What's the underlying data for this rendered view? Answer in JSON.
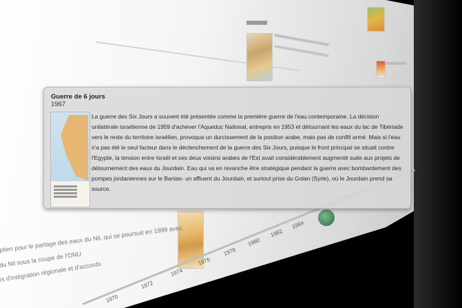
{
  "popover": {
    "title": "Guerre de 6 jours",
    "year": "1967",
    "body": "La guerre des Six Jours a souvent été présentée comme la première guerre de l'eau contemporaine. La décision unilatérale israélienne de 1959 d'achever l'Aqueduc National, entrepris en 1953 et détournant les eaux du lac de Tibériade vers le reste du territoire israélien, provoqua un durcissement de la position arabe, mais pas de conflit armé.  Mais si l'eau n'a pas été le seul facteur dans le déclenchement de la guerre des Six Jours, puisque le front principal se situait contre l'Egypte, la tension entre Israël et ses deux voisins arabes de l'Est avait considérablement augmenté suite aux projets de détournement des eaux du Jourdain. Eau qui va en revanche être stratégique pendant la guerre avec bombardement des pompes jordaniennes sur le Banias- un affluent du Jourdain, et surtout prise du Golan (Syrie), où le Jourdain prend sa source."
  },
  "background": {
    "bottom_lines": [
      "ptien pour le partage des eaux du Nil, qui se poursuit en 1999 avec",
      "du Nil sous la coupe de l'ONU",
      "rs d'intégration régionale et d'accords"
    ],
    "years": [
      "1970",
      "1972",
      "1974",
      "1976",
      "1978",
      "1980",
      "1982",
      "1984"
    ]
  }
}
